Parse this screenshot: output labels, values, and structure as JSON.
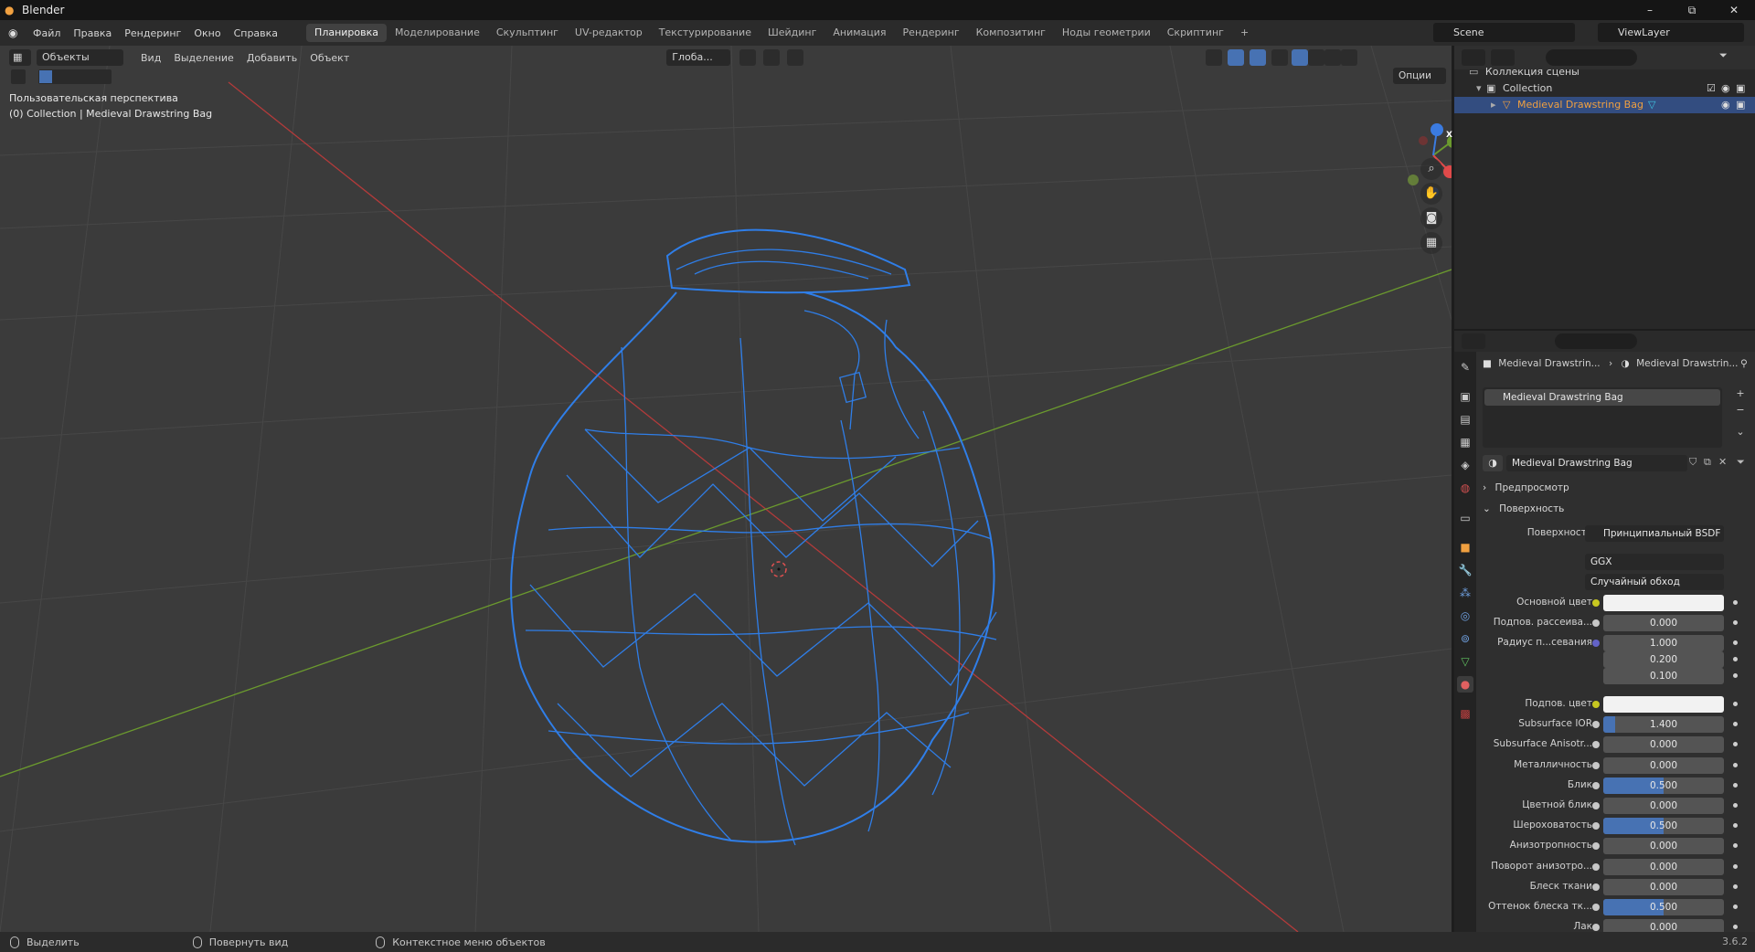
{
  "window": {
    "title": "Blender",
    "minimize": "–",
    "maximize": "⧉",
    "close": "✕"
  },
  "menu": {
    "items": [
      "Файл",
      "Правка",
      "Рендеринг",
      "Окно",
      "Справка"
    ]
  },
  "workspaces": {
    "tabs": [
      "Планировка",
      "Моделирование",
      "Скульптинг",
      "UV-редактор",
      "Текстурирование",
      "Шейдинг",
      "Анимация",
      "Рендеринг",
      "Композитинг",
      "Ноды геометрии",
      "Скриптинг"
    ],
    "active": "Планировка",
    "add": "+"
  },
  "scene": {
    "name": "Scene",
    "view_layer": "ViewLayer"
  },
  "viewport": {
    "mode": "Объекты",
    "menus": [
      "Вид",
      "Выделение",
      "Добавить",
      "Объект"
    ],
    "transform_orientation": "Глоба...",
    "options": "Опции",
    "perspective": "Пользовательская перспектива",
    "collection_info": "(0) Collection | Medieval Drawstring Bag",
    "gizmo_axes": [
      "X",
      "Y",
      "Z"
    ]
  },
  "outliner": {
    "search_placeholder": "",
    "root": "Коллекция сцены",
    "collection": "Collection",
    "object": "Medieval Drawstring Bag"
  },
  "properties": {
    "breadcrumb_object": "Medieval Drawstrin...",
    "breadcrumb_material": "Medieval Drawstrin...",
    "slot": "Medieval Drawstring Bag",
    "material_name": "Medieval Drawstring Bag",
    "panel_preview": "Предпросмотр",
    "panel_surface": "Поверхность",
    "surface_label": "Поверхность",
    "surface_shader": "Принципиальный BSDF",
    "distribution": "GGX",
    "subsurface_method": "Случайный обход",
    "rows": [
      {
        "label": "Основной цвет",
        "type": "color",
        "value": "",
        "dot": "#c7c720"
      },
      {
        "label": "Подпов. рассеива...",
        "type": "num",
        "value": "0.000",
        "dot": "#c7c7c7",
        "fill": 0
      },
      {
        "label": "Радиус п...севания",
        "type": "num",
        "value": "1.000",
        "dot": "#6363c7",
        "fill": 0
      },
      {
        "label": "",
        "type": "num",
        "value": "0.200",
        "dot": "",
        "fill": 0
      },
      {
        "label": "",
        "type": "num",
        "value": "0.100",
        "dot": "",
        "fill": 0
      },
      {
        "label": "Подпов. цвет",
        "type": "color",
        "value": "",
        "dot": "#c7c720"
      },
      {
        "label": "Subsurface IOR",
        "type": "num",
        "value": "1.400",
        "dot": "#c7c7c7",
        "fill": 0.1
      },
      {
        "label": "Subsurface Anisotr...",
        "type": "num",
        "value": "0.000",
        "dot": "#c7c7c7",
        "fill": 0
      },
      {
        "label": "Металличность",
        "type": "num",
        "value": "0.000",
        "dot": "#c7c7c7",
        "fill": 0
      },
      {
        "label": "Блик",
        "type": "num",
        "value": "0.500",
        "dot": "#c7c7c7",
        "fill": 0.5
      },
      {
        "label": "Цветной блик",
        "type": "num",
        "value": "0.000",
        "dot": "#c7c7c7",
        "fill": 0
      },
      {
        "label": "Шероховатость",
        "type": "num",
        "value": "0.500",
        "dot": "#c7c7c7",
        "fill": 0.5
      },
      {
        "label": "Анизотропность",
        "type": "num",
        "value": "0.000",
        "dot": "#c7c7c7",
        "fill": 0
      },
      {
        "label": "Поворот анизотро...",
        "type": "num",
        "value": "0.000",
        "dot": "#c7c7c7",
        "fill": 0
      },
      {
        "label": "Блеск ткани",
        "type": "num",
        "value": "0.000",
        "dot": "#c7c7c7",
        "fill": 0
      },
      {
        "label": "Оттенок блеска тк...",
        "type": "num",
        "value": "0.500",
        "dot": "#c7c7c7",
        "fill": 0.5
      },
      {
        "label": "Лак",
        "type": "num",
        "value": "0.000",
        "dot": "#c7c7c7",
        "fill": 0
      }
    ]
  },
  "status": {
    "select": "Выделить",
    "rotate": "Повернуть вид",
    "context": "Контекстное меню объектов",
    "version": "3.6.2"
  },
  "colors": {
    "accent": "#4772b3",
    "wire": "#2f7ee8",
    "axis_x": "#b33b3b",
    "axis_y": "#6b9a2e",
    "selected_object": "#f0a040"
  }
}
